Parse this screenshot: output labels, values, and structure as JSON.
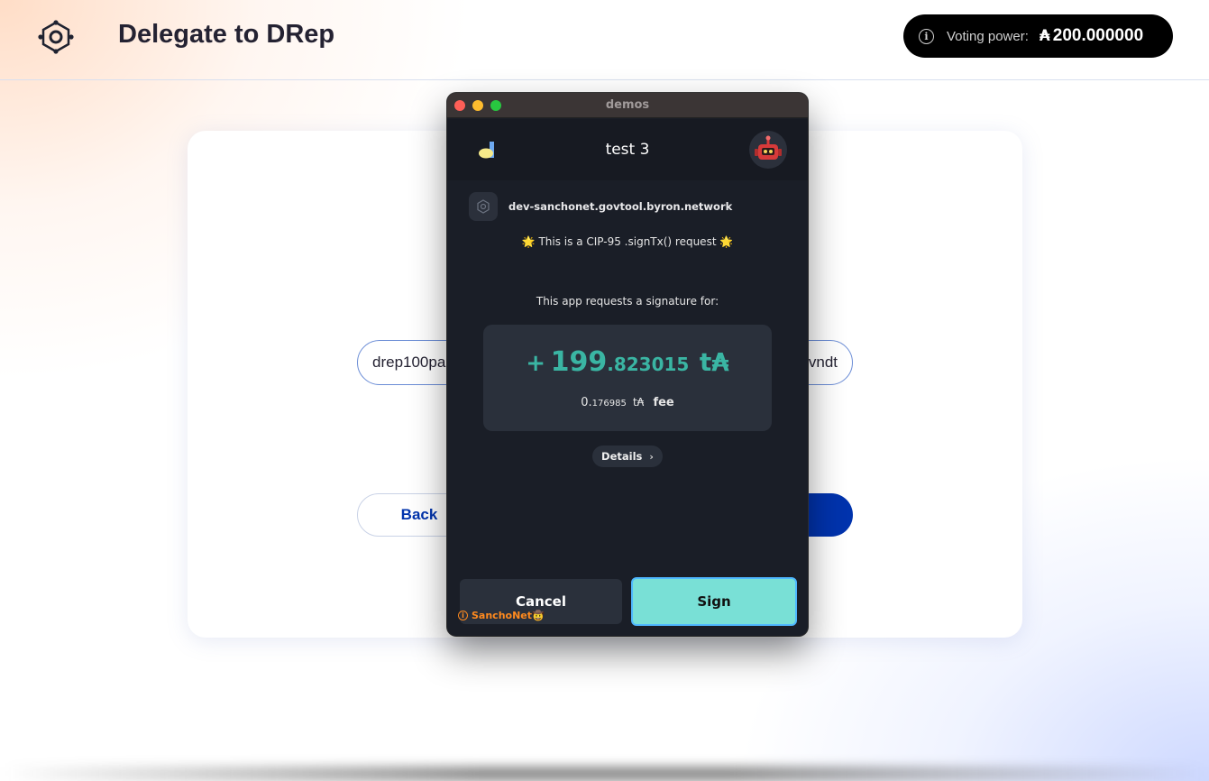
{
  "header": {
    "title": "Delegate to DRep",
    "voting_power_label": "Voting power:",
    "voting_power_value": "200.000000",
    "ada_symbol": "₳"
  },
  "main": {
    "drep_input_left": "drep100pa",
    "drep_input_right": "vndt",
    "back_label": "Back"
  },
  "popup": {
    "window_title": "demos",
    "account_name": "test 3",
    "dapp_url": "dev-sanchonet.govtool.byron.network",
    "cip_request": "This is a CIP-95 .signTx() request",
    "request_text": "This app requests a signature for:",
    "amount_sign": "+",
    "amount_integer": "199",
    "amount_decimal": ".823015",
    "amount_unit": "t₳",
    "fee_integer": "0.",
    "fee_decimal": "176985",
    "fee_unit": "t₳",
    "fee_label": "fee",
    "details_label": "Details",
    "cancel_label": "Cancel",
    "sign_label": "Sign",
    "network_label": "SanchoNet🤠"
  },
  "colors": {
    "accent_blue": "#0033ad",
    "sign_teal": "#79e0d6",
    "amount_teal": "#3ab5a3",
    "network_orange": "#ff8a1e"
  }
}
